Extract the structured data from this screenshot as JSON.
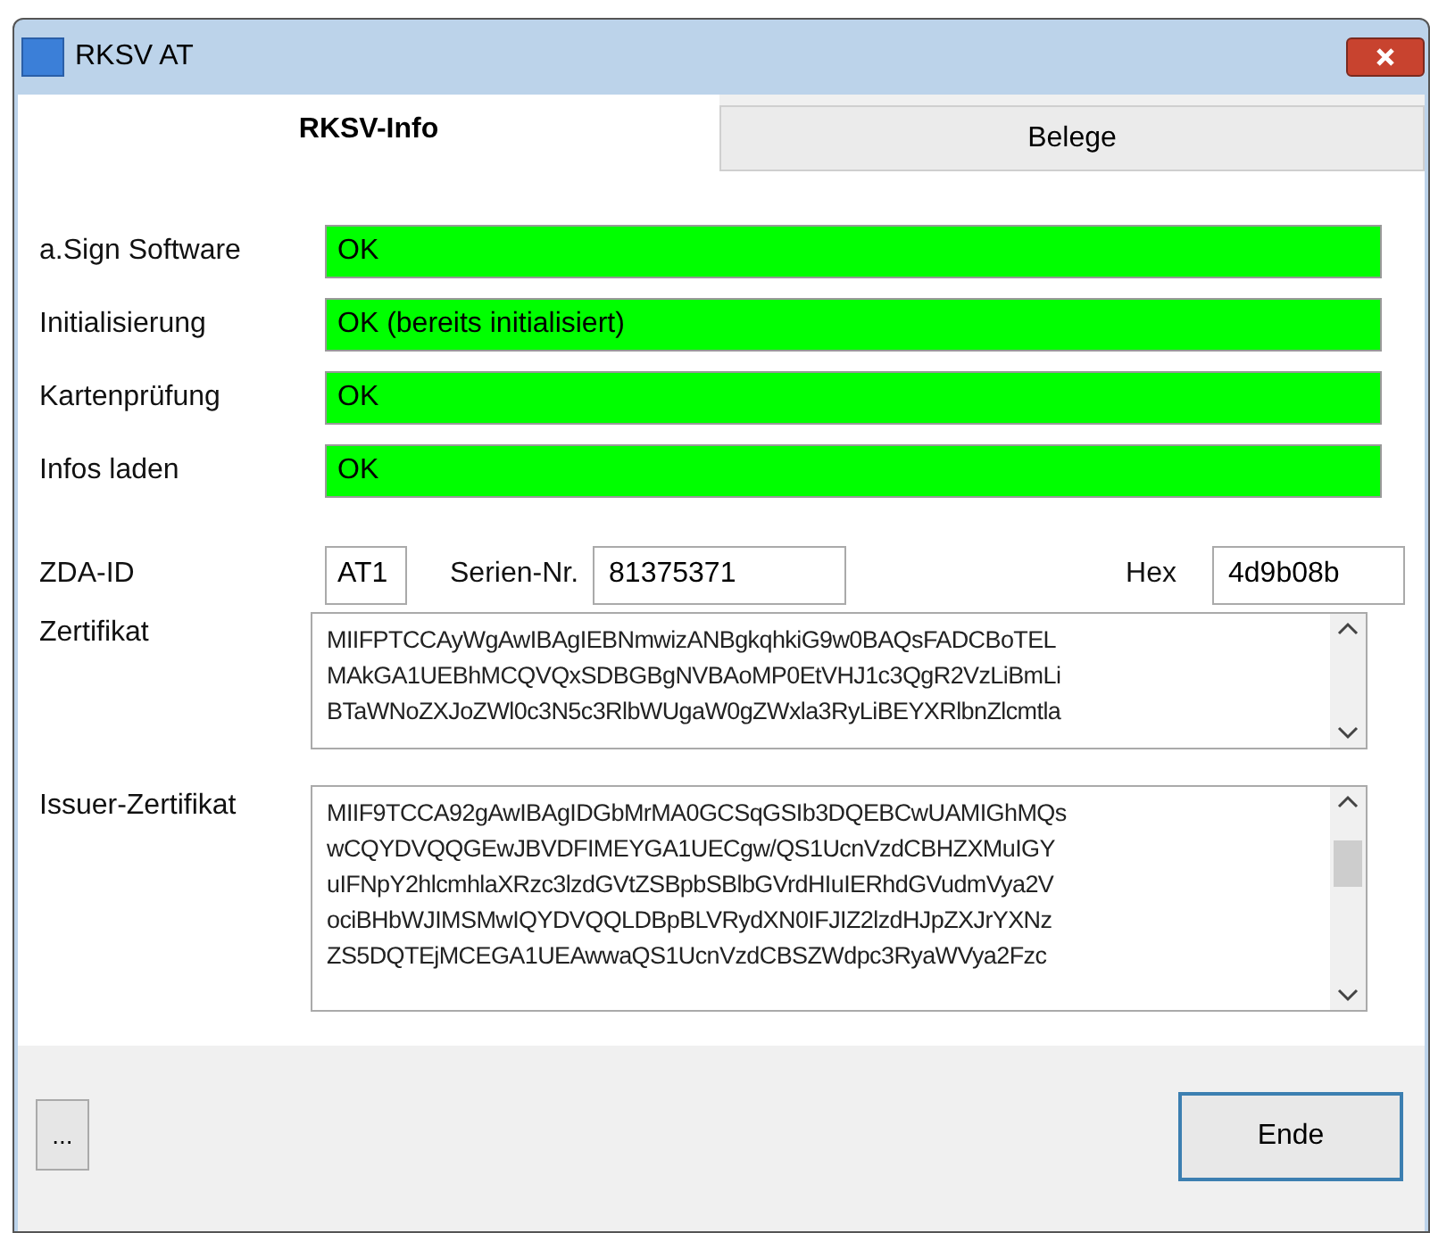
{
  "window": {
    "title": "RKSV AT"
  },
  "tabs": [
    {
      "label": "RKSV-Info",
      "selected": true
    },
    {
      "label": "Belege",
      "selected": false
    }
  ],
  "status_rows": [
    {
      "label": "a.Sign Software",
      "value": "OK",
      "ok": true
    },
    {
      "label": "Initialisierung",
      "value": "OK (bereits initialisiert)",
      "ok": true
    },
    {
      "label": "Kartenprüfung",
      "value": "OK",
      "ok": true
    },
    {
      "label": "Infos laden",
      "value": "OK",
      "ok": true
    }
  ],
  "zda": {
    "label": "ZDA-ID",
    "value": "AT1"
  },
  "serial": {
    "label": "Serien-Nr.",
    "value": "81375371"
  },
  "hex": {
    "label": "Hex",
    "value": "4d9b08b"
  },
  "certificate": {
    "label": "Zertifikat",
    "lines": [
      "MIIFPTCCAyWgAwIBAgIEBNmwizANBgkqhkiG9w0BAQsFADCBoTEL",
      "MAkGA1UEBhMCQVQxSDBGBgNVBAoMP0EtVHJ1c3QgR2VzLiBmLi",
      "BTaWNoZXJoZWl0c3N5c3RlbWUgaW0gZWxla3RyLiBEYXRlbnZlcmtla"
    ]
  },
  "issuer_certificate": {
    "label": "Issuer-Zertifikat",
    "lines": [
      "MIIF9TCCA92gAwIBAgIDGbMrMA0GCSqGSIb3DQEBCwUAMIGhMQs",
      "wCQYDVQQGEwJBVDFIMEYGA1UECgw/QS1UcnVzdCBHZXMuIGY",
      "uIFNpY2hlcmhlaXRzc3lzdGVtZSBpbSBlbGVrdHIuIERhdGVudmVya2V",
      "ociBHbWJIMSMwIQYDVQQLDBpBLVRydXN0IFJIZ2lzdHJpZXJrYXNz",
      "ZS5DQTEjMCEGA1UEAwwaQS1UcnVzdCBSZWdpc3RyaWVya2Fzc"
    ]
  },
  "buttons": {
    "more": "...",
    "close": "Ende"
  }
}
